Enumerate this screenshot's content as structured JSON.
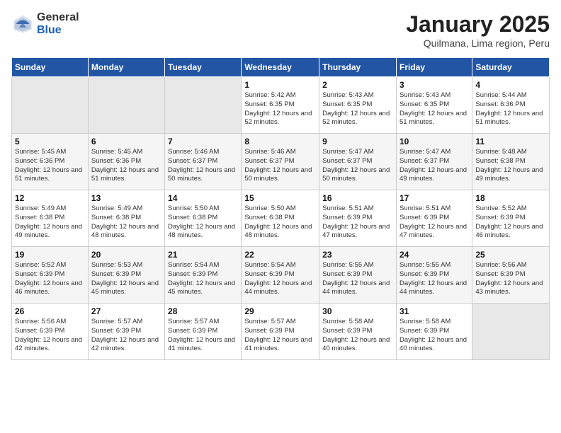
{
  "header": {
    "logo_general": "General",
    "logo_blue": "Blue",
    "title": "January 2025",
    "subtitle": "Quilmana, Lima region, Peru"
  },
  "weekdays": [
    "Sunday",
    "Monday",
    "Tuesday",
    "Wednesday",
    "Thursday",
    "Friday",
    "Saturday"
  ],
  "weeks": [
    [
      {
        "day": "",
        "empty": true
      },
      {
        "day": "",
        "empty": true
      },
      {
        "day": "",
        "empty": true
      },
      {
        "day": "1",
        "sunrise": "5:42 AM",
        "sunset": "6:35 PM",
        "daylight": "12 hours and 52 minutes."
      },
      {
        "day": "2",
        "sunrise": "5:43 AM",
        "sunset": "6:35 PM",
        "daylight": "12 hours and 52 minutes."
      },
      {
        "day": "3",
        "sunrise": "5:43 AM",
        "sunset": "6:35 PM",
        "daylight": "12 hours and 51 minutes."
      },
      {
        "day": "4",
        "sunrise": "5:44 AM",
        "sunset": "6:36 PM",
        "daylight": "12 hours and 51 minutes."
      }
    ],
    [
      {
        "day": "5",
        "sunrise": "5:45 AM",
        "sunset": "6:36 PM",
        "daylight": "12 hours and 51 minutes."
      },
      {
        "day": "6",
        "sunrise": "5:45 AM",
        "sunset": "6:36 PM",
        "daylight": "12 hours and 51 minutes."
      },
      {
        "day": "7",
        "sunrise": "5:46 AM",
        "sunset": "6:37 PM",
        "daylight": "12 hours and 50 minutes."
      },
      {
        "day": "8",
        "sunrise": "5:46 AM",
        "sunset": "6:37 PM",
        "daylight": "12 hours and 50 minutes."
      },
      {
        "day": "9",
        "sunrise": "5:47 AM",
        "sunset": "6:37 PM",
        "daylight": "12 hours and 50 minutes."
      },
      {
        "day": "10",
        "sunrise": "5:47 AM",
        "sunset": "6:37 PM",
        "daylight": "12 hours and 49 minutes."
      },
      {
        "day": "11",
        "sunrise": "5:48 AM",
        "sunset": "6:38 PM",
        "daylight": "12 hours and 49 minutes."
      }
    ],
    [
      {
        "day": "12",
        "sunrise": "5:49 AM",
        "sunset": "6:38 PM",
        "daylight": "12 hours and 49 minutes."
      },
      {
        "day": "13",
        "sunrise": "5:49 AM",
        "sunset": "6:38 PM",
        "daylight": "12 hours and 48 minutes."
      },
      {
        "day": "14",
        "sunrise": "5:50 AM",
        "sunset": "6:38 PM",
        "daylight": "12 hours and 48 minutes."
      },
      {
        "day": "15",
        "sunrise": "5:50 AM",
        "sunset": "6:38 PM",
        "daylight": "12 hours and 48 minutes."
      },
      {
        "day": "16",
        "sunrise": "5:51 AM",
        "sunset": "6:39 PM",
        "daylight": "12 hours and 47 minutes."
      },
      {
        "day": "17",
        "sunrise": "5:51 AM",
        "sunset": "6:39 PM",
        "daylight": "12 hours and 47 minutes."
      },
      {
        "day": "18",
        "sunrise": "5:52 AM",
        "sunset": "6:39 PM",
        "daylight": "12 hours and 46 minutes."
      }
    ],
    [
      {
        "day": "19",
        "sunrise": "5:52 AM",
        "sunset": "6:39 PM",
        "daylight": "12 hours and 46 minutes."
      },
      {
        "day": "20",
        "sunrise": "5:53 AM",
        "sunset": "6:39 PM",
        "daylight": "12 hours and 45 minutes."
      },
      {
        "day": "21",
        "sunrise": "5:54 AM",
        "sunset": "6:39 PM",
        "daylight": "12 hours and 45 minutes."
      },
      {
        "day": "22",
        "sunrise": "5:54 AM",
        "sunset": "6:39 PM",
        "daylight": "12 hours and 44 minutes."
      },
      {
        "day": "23",
        "sunrise": "5:55 AM",
        "sunset": "6:39 PM",
        "daylight": "12 hours and 44 minutes."
      },
      {
        "day": "24",
        "sunrise": "5:55 AM",
        "sunset": "6:39 PM",
        "daylight": "12 hours and 44 minutes."
      },
      {
        "day": "25",
        "sunrise": "5:56 AM",
        "sunset": "6:39 PM",
        "daylight": "12 hours and 43 minutes."
      }
    ],
    [
      {
        "day": "26",
        "sunrise": "5:56 AM",
        "sunset": "6:39 PM",
        "daylight": "12 hours and 42 minutes."
      },
      {
        "day": "27",
        "sunrise": "5:57 AM",
        "sunset": "6:39 PM",
        "daylight": "12 hours and 42 minutes."
      },
      {
        "day": "28",
        "sunrise": "5:57 AM",
        "sunset": "6:39 PM",
        "daylight": "12 hours and 41 minutes."
      },
      {
        "day": "29",
        "sunrise": "5:57 AM",
        "sunset": "6:39 PM",
        "daylight": "12 hours and 41 minutes."
      },
      {
        "day": "30",
        "sunrise": "5:58 AM",
        "sunset": "6:39 PM",
        "daylight": "12 hours and 40 minutes."
      },
      {
        "day": "31",
        "sunrise": "5:58 AM",
        "sunset": "6:39 PM",
        "daylight": "12 hours and 40 minutes."
      },
      {
        "day": "",
        "empty": true
      }
    ]
  ],
  "labels": {
    "sunrise_prefix": "Sunrise: ",
    "sunset_prefix": "Sunset: ",
    "daylight_prefix": "Daylight: "
  }
}
